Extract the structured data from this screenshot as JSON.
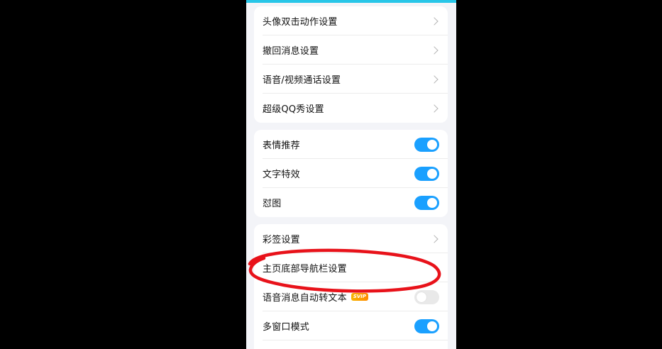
{
  "group1": {
    "items": [
      {
        "label": "头像双击动作设置"
      },
      {
        "label": "撤回消息设置"
      },
      {
        "label": "语音/视频通话设置"
      },
      {
        "label": "超级QQ秀设置"
      }
    ]
  },
  "group2": {
    "items": [
      {
        "label": "表情推荐",
        "toggle": "on"
      },
      {
        "label": "文字特效",
        "toggle": "on"
      },
      {
        "label": "怼图",
        "toggle": "on"
      }
    ]
  },
  "group3": {
    "items": [
      {
        "label": "彩签设置"
      },
      {
        "label": "主页底部导航栏设置"
      },
      {
        "label": "语音消息自动转文本",
        "badge": "SVIP",
        "toggle": "off"
      },
      {
        "label": "多窗口模式",
        "toggle": "on"
      }
    ]
  },
  "colors": {
    "toggle_on": "#1aa0ff",
    "toggle_off": "#e9e9e9",
    "annotation": "#e8121a",
    "top_accent": "#27c6e8"
  }
}
